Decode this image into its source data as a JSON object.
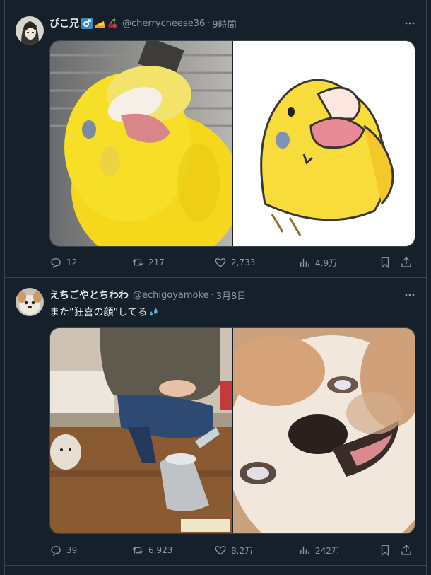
{
  "tweets": [
    {
      "display_name": "ぴこ兄",
      "handle": "@cherrycheese36",
      "separator": "·",
      "time": "9時間",
      "text": "",
      "stats": {
        "replies": "12",
        "retweets": "217",
        "likes": "2,733",
        "views": "4.9万"
      }
    },
    {
      "display_name": "えちごやとちわわ",
      "handle": "@echigoyamoke",
      "separator": "·",
      "time": "3月8日",
      "text": "また\"狂喜の顔\"してる",
      "stats": {
        "replies": "39",
        "retweets": "6,923",
        "likes": "8.2万",
        "views": "242万"
      }
    }
  ],
  "colors": {
    "background": "#15202b",
    "border": "#38444d",
    "muted": "#8b98a5",
    "text": "#e7e9ea"
  },
  "icons": [
    "reply-icon",
    "retweet-icon",
    "like-icon",
    "views-icon",
    "bookmark-icon",
    "share-icon",
    "more-icon"
  ]
}
